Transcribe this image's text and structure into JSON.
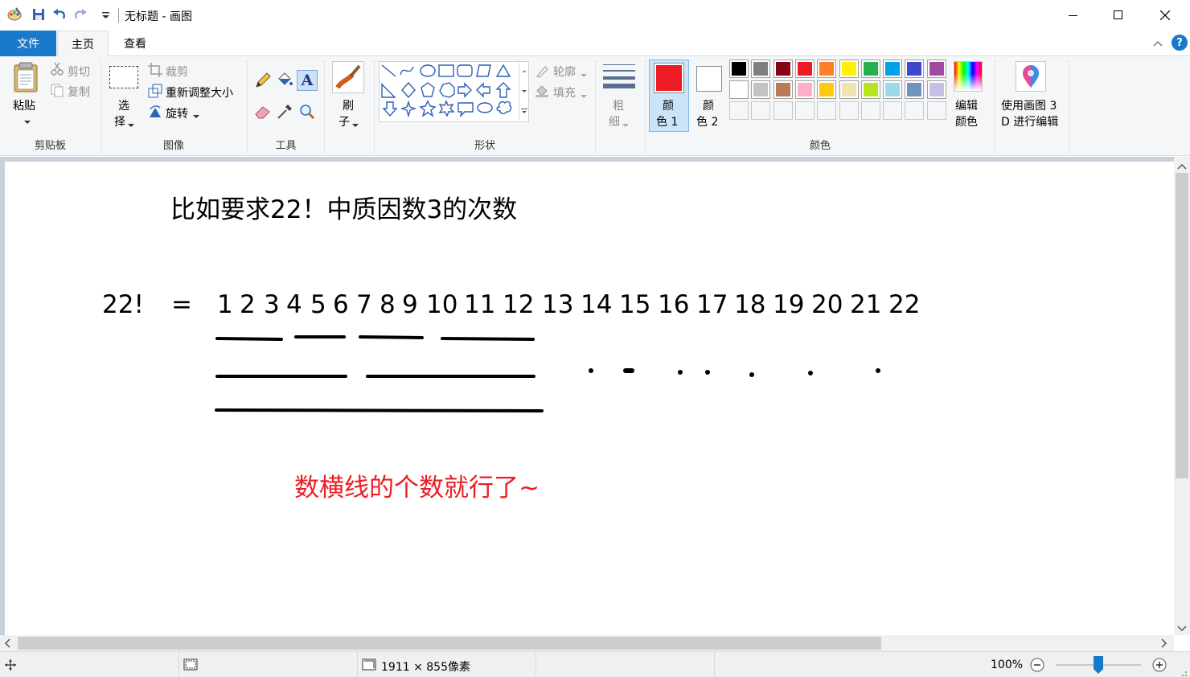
{
  "window": {
    "title": "无标题 - 画图",
    "controls": [
      "minimize",
      "maximize",
      "close"
    ]
  },
  "tabs": [
    {
      "label": "文件"
    },
    {
      "label": "主页"
    },
    {
      "label": "查看"
    }
  ],
  "ribbon": {
    "clipboard": {
      "paste": "粘贴",
      "cut": "剪切",
      "copy": "复制",
      "label": "剪贴板"
    },
    "image": {
      "select_1": "选",
      "select_2": "择",
      "crop": "裁剪",
      "resize": "重新调整大小",
      "rotate": "旋转",
      "label": "图像"
    },
    "tools": {
      "label": "工具"
    },
    "brushes": {
      "l1": "刷",
      "l2": "子"
    },
    "shapes": {
      "outline": "轮廓",
      "fill": "填充",
      "label": "形状"
    },
    "size": {
      "l1": "粗",
      "l2": "细"
    },
    "colors": {
      "color1_l1": "颜",
      "color1_l2": "色 1",
      "color2_l1": "颜",
      "color2_l2": "色 2",
      "color1": "#ed1c24",
      "color2": "#ffffff",
      "edit_l1": "编辑",
      "edit_l2": "颜色",
      "label": "颜色",
      "palette_row1": [
        "#000000",
        "#7f7f7f",
        "#880015",
        "#ed1c24",
        "#ff7f27",
        "#fff200",
        "#22b14c",
        "#00a2e8",
        "#3f48cc",
        "#a349a4"
      ],
      "palette_row2": [
        "#ffffff",
        "#c3c3c3",
        "#b97a57",
        "#ffaec9",
        "#ffc90e",
        "#efe4b0",
        "#b5e61d",
        "#99d9ea",
        "#7092be",
        "#c8bfe7"
      ]
    },
    "paint3d": {
      "l1": "使用画图 3",
      "l2": "D 进行编辑"
    }
  },
  "canvas": {
    "heading": "比如要求22！中质因数3的次数",
    "lhs": "22!",
    "equals": "=",
    "numbers": [
      "1",
      "2",
      "3",
      "4",
      "5",
      "6",
      "7",
      "8",
      "9",
      "10",
      "11",
      "12",
      "13",
      "14",
      "15",
      "16",
      "17",
      "18",
      "19",
      "20",
      "21",
      "22"
    ],
    "note": "数横线的个数就行了~",
    "note_color": "#ed1c24"
  },
  "statusbar": {
    "dimensions": "1911 × 855像素",
    "zoom": "100%",
    "zoom_level": 0.5
  }
}
